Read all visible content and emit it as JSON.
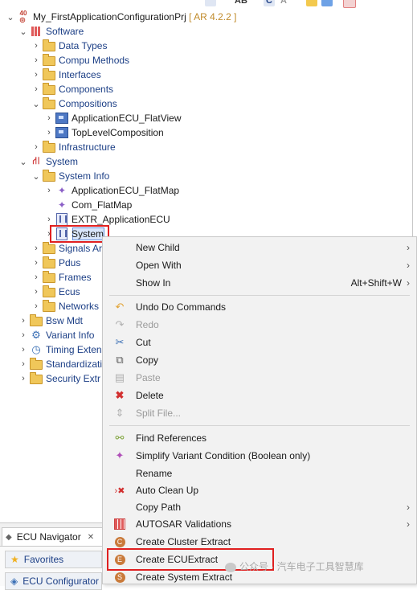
{
  "toolbar_partial": [
    "AB",
    "C",
    "A"
  ],
  "tree": {
    "project": {
      "name": "My_FirstApplicationConfigurationPrj",
      "suffix": "[ AR 4.2.2 ]"
    },
    "software": "Software",
    "data_types": "Data Types",
    "compu_methods": "Compu Methods",
    "interfaces": "Interfaces",
    "components": "Components",
    "compositions": "Compositions",
    "app_ecu_flatview": "ApplicationECU_FlatView",
    "toplevel_composition": "TopLevelComposition",
    "infrastructure": "Infrastructure",
    "system": "System",
    "system_info": "System Info",
    "app_ecu_flatmap": "ApplicationECU_FlatMap",
    "com_flatmap": "Com_FlatMap",
    "extr_app_ecu": "EXTR_ApplicationECU",
    "system_node": "System",
    "signals": "Signals Ar",
    "pdus": "Pdus",
    "frames": "Frames",
    "ecus": "Ecus",
    "networks": "Networks",
    "bsw_mdt": "Bsw Mdt",
    "variant_info": "Variant Info",
    "timing": "Timing Exten",
    "standardization": "Standardizati",
    "security": "Security Extr"
  },
  "menu": {
    "new_child": "New Child",
    "open_with": "Open With",
    "show_in": "Show In",
    "show_in_shortcut": "Alt+Shift+W",
    "undo": "Undo Do Commands",
    "redo": "Redo",
    "cut": "Cut",
    "copy": "Copy",
    "paste": "Paste",
    "delete": "Delete",
    "split_file": "Split File...",
    "find_references": "Find References",
    "simplify_variant": "Simplify Variant Condition (Boolean only)",
    "rename": "Rename",
    "auto_clean_up": "Auto Clean Up",
    "copy_path": "Copy Path",
    "autosar_validations": "AUTOSAR Validations",
    "create_cluster_extract": "Create Cluster Extract",
    "create_ecu_extract": "Create ECUExtract",
    "create_system_extract": "Create System Extract"
  },
  "bottom_panel": {
    "tab": "ECU Navigator",
    "close": "✕",
    "favorites": "Favorites",
    "ecu_configurator": "ECU Configurator"
  },
  "watermark": "公众号 · 汽车电子工具智慧库",
  "colors": {
    "highlight_red": "#e02020",
    "label_blue": "#1c3f86",
    "folder_yellow": "#f0c75a"
  }
}
